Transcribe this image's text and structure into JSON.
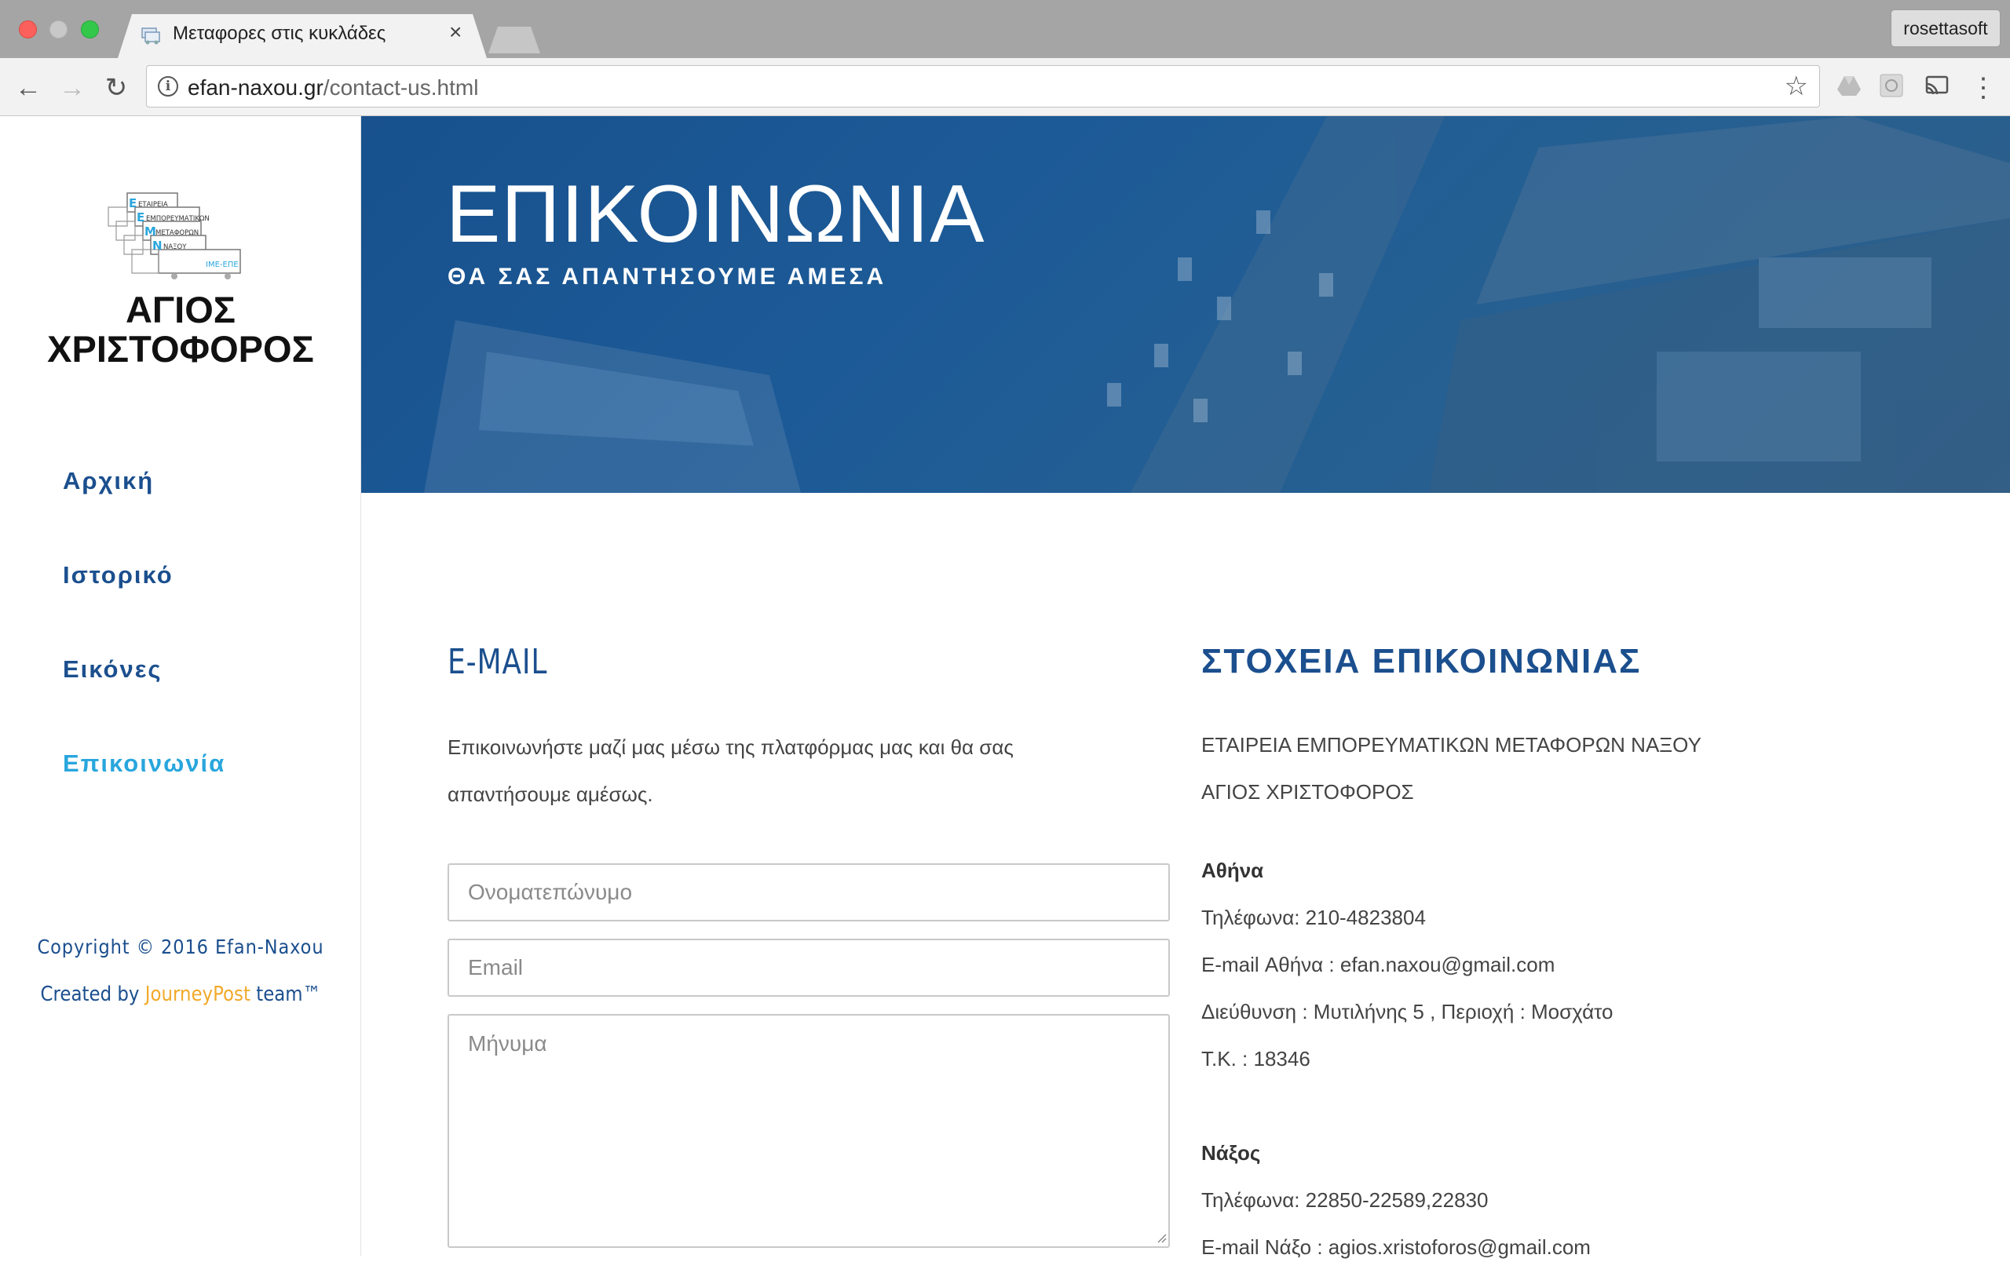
{
  "browser": {
    "tab_title": "Μεταφορες στις κυκλάδες",
    "profile": "rosettasoft",
    "url_host": "efan-naxou.gr",
    "url_path": "/contact-us.html"
  },
  "sidebar": {
    "logo_line1": "ΑΓΙΟΣ",
    "logo_line2": "ΧΡΙΣΤΟΦΟΡΟΣ",
    "logo_graphic_lines": [
      "ΕΤΑΙΡΕΙΑ",
      "ΕΜΠΟΡΕΥΜΑΤΙΚΩΝ",
      "ΜΕΤΑΦΟΡΩΝ",
      "ΝΑΞΟΥ",
      "ΙΜΕ-ΕΠΕ"
    ],
    "nav": [
      {
        "label": "Αρχική"
      },
      {
        "label": "Ιστορικό"
      },
      {
        "label": "Εικόνες"
      },
      {
        "label": "Επικοινωνία"
      }
    ],
    "copyright": "Copyright © 2016 Efan-Naxou",
    "created_prefix": "Created by ",
    "created_brand": "JourneyPost",
    "created_suffix": " team™",
    "brand_color": "#f2a92b"
  },
  "hero": {
    "title": "ΕΠΙΚΟΙΝΩΝΙΑ",
    "subtitle": "ΘΑ ΣΑΣ ΑΠΑΝΤΗΣΟΥΜΕ ΑΜΕΣΑ",
    "overlay_color": "#1b5592"
  },
  "form": {
    "heading": "E-MAIL",
    "intro": "Επικοινωνήστε μαζί μας μέσω της πλατφόρμας μας και θα σας απαντήσουμε αμέσως.",
    "name_placeholder": "Ονοματεπώνυμο",
    "email_placeholder": "Email",
    "message_placeholder": "Μήνυμα"
  },
  "contact": {
    "heading": "ΣΤΟΧΕΙΑ ΕΠΙΚΟΙΝΩΝΙΑΣ",
    "company_line1": "ΕΤΑΙΡΕΙΑ ΕΜΠΟΡΕΥΜΑΤΙΚΩΝ ΜΕΤΑΦΟΡΩΝ ΝΑΞΟΥ",
    "company_line2": "ΑΓΙΟΣ ΧΡΙΣΤΟΦΟΡΟΣ",
    "athens": {
      "city": "Αθήνα",
      "phone": "Τηλέφωνα:   210-4823804",
      "email": "E-mail Αθήνα :   efan.naxou@gmail.com",
      "address": "Διεύθυνση : Μυτιλήνης 5 , Περιοχή : Μοσχάτο",
      "postcode": "Τ.Κ. : 18346"
    },
    "naxos": {
      "city": "Νάξος",
      "phone": "Τηλέφωνα: 22850-22589,22830",
      "email": "E-mail Νάξο :   agios.xristoforos@gmail.com"
    }
  },
  "colors": {
    "primary_blue": "#1b4f8e",
    "active_nav": "#29a6dd"
  }
}
